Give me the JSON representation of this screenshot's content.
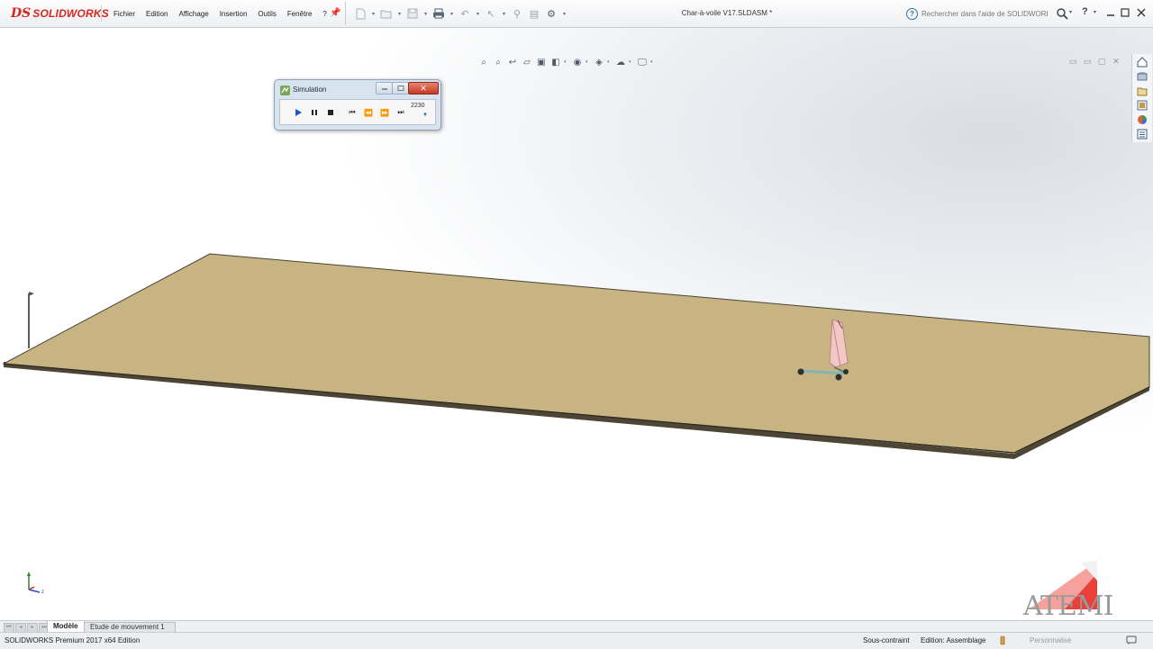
{
  "app": {
    "brand_prefix": "DS",
    "brand": "SOLIDWORKS",
    "document_title": "Char-à-voile V17.SLDASM *"
  },
  "menu": {
    "items": [
      "Fichier",
      "Edition",
      "Affichage",
      "Insertion",
      "Outils",
      "Fenêtre",
      "?"
    ]
  },
  "search": {
    "placeholder": "Rechercher dans l'aide de SOLIDWORKS"
  },
  "simulation": {
    "title": "Simulation",
    "frame": "2230"
  },
  "tabs": {
    "model": "Modèle",
    "motion_study": "Etude de mouvement 1"
  },
  "status": {
    "product": "SOLIDWORKS Premium 2017 x64 Edition",
    "constraint": "Sous-contraint",
    "mode": "Edition: Assemblage",
    "units": "Personnalisé"
  },
  "watermark": {
    "text": "ATEMI"
  },
  "colors": {
    "brand_red": "#d9261c",
    "ground": "#c8b482",
    "sail": "#f1c8c5",
    "atemi_red": "#e9403a"
  }
}
